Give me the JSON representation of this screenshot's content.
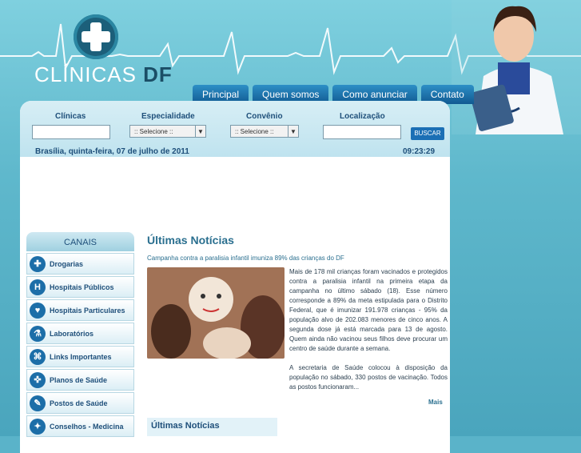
{
  "header": {
    "logo_main": "CLÍNICAS",
    "logo_suffix": "DF",
    "nav": [
      "Principal",
      "Quem somos",
      "Como anunciar",
      "Contato"
    ]
  },
  "search": {
    "clinicas_label": "Clínicas",
    "especialidade_label": "Especialidade",
    "especialidade_value": ":: Selecione ::",
    "convenio_label": "Convênio",
    "convenio_value": ":: Selecione ::",
    "localizacao_label": "Localização",
    "button_label": "BUSCAR"
  },
  "date_line": "Brasília, quinta-feira, 07 de julho de 2011",
  "time": "09:23:29",
  "sidebar": {
    "title": "CANAIS",
    "items": [
      {
        "label": "Drogarias",
        "icon": "pill-icon"
      },
      {
        "label": "Hospitais Públicos",
        "icon": "hospital-icon"
      },
      {
        "label": "Hospitais Particulares",
        "icon": "stethoscope-icon"
      },
      {
        "label": "Laboratórios",
        "icon": "flask-icon"
      },
      {
        "label": "Links Importantes",
        "icon": "link-icon"
      },
      {
        "label": "Planos de Saúde",
        "icon": "plan-icon"
      },
      {
        "label": "Postos de Saúde",
        "icon": "syringe-icon"
      },
      {
        "label": "Conselhos - Medicina",
        "icon": "council-icon"
      }
    ]
  },
  "news": {
    "title": "Últimas Notícias",
    "headline": "Campanha contra a paralisia infantil imuniza 89% das crianças do DF",
    "body_1": "Mais de 178 mil crianças foram vacinados e protegidos contra a paralisia infantil na primeira etapa da campanha no último sábado (18). Esse número corresponde a 89% da meta estipulada para o Distrito Federal, que é imunizar 191.978 crianças - 95% da população alvo de 202.083 menores de cinco anos. A segunda dose já está marcada para 13 de agosto. Quem ainda não vacinou seus filhos deve procurar um centro de saúde durante a semana.",
    "body_2": "A secretaria de Saúde colocou à disposição da população no sábado, 330 postos de vacinação. Todos as postos funcionaram...",
    "more_link": "Mais",
    "box_title": "Últimas Notícias"
  }
}
